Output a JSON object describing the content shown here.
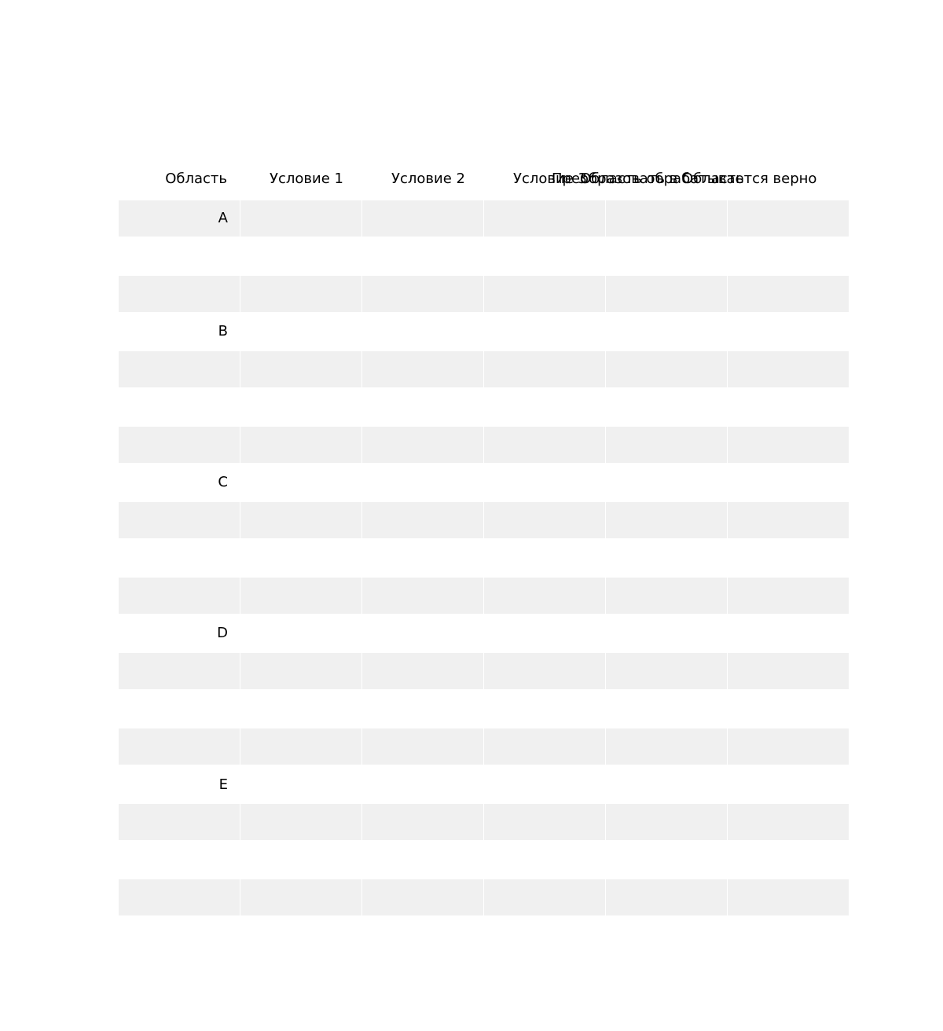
{
  "table": {
    "headers": {
      "area": "Область",
      "cond1": "Условие 1",
      "cond2": "Условие 2",
      "cond3": "Условие 3",
      "transform": "Преобразовать в Область",
      "correct": "Область обрабатывается верно"
    },
    "areas": [
      "A",
      "B",
      "C",
      "D",
      "E"
    ]
  }
}
